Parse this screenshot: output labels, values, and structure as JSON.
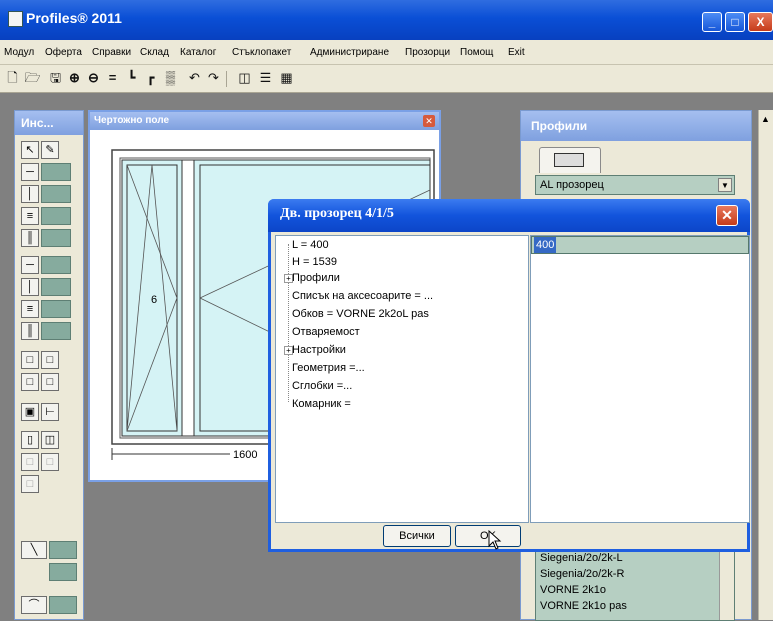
{
  "window": {
    "title": "Profiles® 2011",
    "controls": {
      "minimize": "_",
      "maximize": "□",
      "close": "X"
    }
  },
  "menu": [
    "Модул",
    "Оферта",
    "Справки",
    "Склад",
    "Каталог",
    "Стъклопакет",
    "Администриране",
    "Прозорци",
    "Помощ",
    "Exit"
  ],
  "toolbar_icons": [
    "new-icon",
    "open-icon",
    "save-icon",
    "zoom-in-icon",
    "zoom-out-icon",
    "equal-icon",
    "profile-l-icon",
    "profile-t-icon",
    "grid-icon",
    "undo-icon",
    "redo-icon",
    "view-split-icon",
    "view-list-icon",
    "view-table-icon"
  ],
  "tool_panel": {
    "title": "Инс..."
  },
  "draw_window": {
    "title": "Чертожно поле",
    "sash_label": "6",
    "dimension": "1600"
  },
  "profiles_panel": {
    "title": "Профили",
    "select_value": "AL прозорец",
    "list_items": [
      "Siegenia/2o/2k-L",
      "Siegenia/2o/2k-R",
      "VORNE 2k1o",
      "VORNE 2k1o pas"
    ]
  },
  "dialog": {
    "title": "Дв. прозорец  4/1/5",
    "tree": [
      {
        "text": "L = 400",
        "expander": false
      },
      {
        "text": "H = 1539",
        "expander": false
      },
      {
        "text": "Профили",
        "expander": true
      },
      {
        "text": "Списък на аксесоарите = ...",
        "expander": false
      },
      {
        "text": "Обков =  VORNE 2k2oL pas",
        "expander": false
      },
      {
        "text": "Отваряемост",
        "expander": false
      },
      {
        "text": "Настройки",
        "expander": true
      },
      {
        "text": "Геометрия  =...",
        "expander": false
      },
      {
        "text": "Сглобки  =...",
        "expander": false
      },
      {
        "text": "Комарник =",
        "expander": false
      }
    ],
    "value_field": "400",
    "all_button": "Всички",
    "ok_button": "OK"
  },
  "colors": {
    "titlebar": "#0a4fd6",
    "panel": "#ece9d8",
    "field": "#b6cfc2",
    "selection": "#3569c5"
  }
}
